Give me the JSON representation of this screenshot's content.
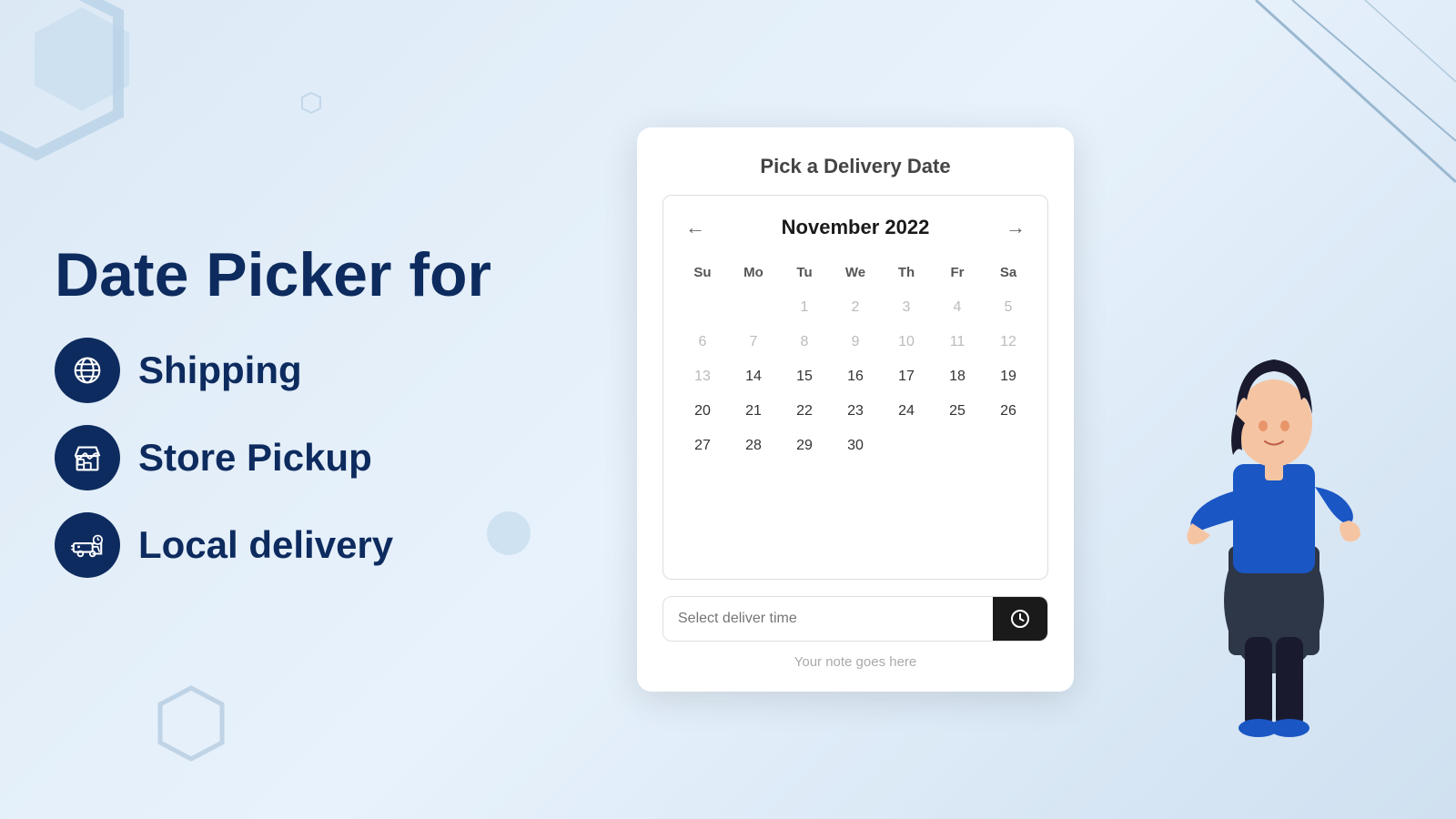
{
  "left": {
    "main_title": "Date Picker for",
    "features": [
      {
        "id": "shipping",
        "label": "Shipping",
        "icon": "globe-icon"
      },
      {
        "id": "store-pickup",
        "label": "Store Pickup",
        "icon": "store-icon"
      },
      {
        "id": "local-delivery",
        "label": "Local delivery",
        "icon": "delivery-icon"
      }
    ]
  },
  "calendar": {
    "card_title": "Pick a Delivery Date",
    "month_year": "November 2022",
    "prev_label": "←",
    "next_label": "→",
    "day_headers": [
      "Su",
      "Mo",
      "Tu",
      "We",
      "Th",
      "Fr",
      "Sa"
    ],
    "rows": [
      [
        "",
        "",
        "1",
        "2",
        "3",
        "4",
        "5"
      ],
      [
        "6",
        "7",
        "8",
        "9",
        "10",
        "11",
        "12"
      ],
      [
        "13",
        "14",
        "15",
        "16",
        "17",
        "18",
        "19"
      ],
      [
        "20",
        "21",
        "22",
        "23",
        "24",
        "25",
        "26"
      ],
      [
        "27",
        "28",
        "29",
        "30",
        "",
        "",
        ""
      ]
    ],
    "disabled_days": [
      "1",
      "2",
      "3",
      "4",
      "5",
      "6",
      "7",
      "8",
      "9",
      "10",
      "11",
      "12",
      "13"
    ],
    "time_placeholder": "Select deliver time",
    "note_placeholder": "Your note goes here"
  }
}
